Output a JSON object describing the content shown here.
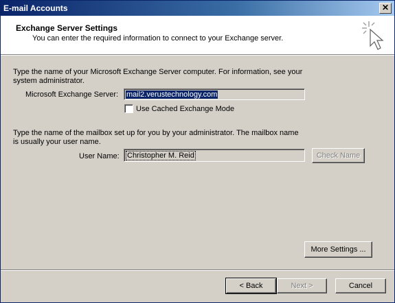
{
  "window": {
    "title": "E-mail Accounts",
    "close_glyph": "✕"
  },
  "header": {
    "title": "Exchange Server Settings",
    "subtitle": "You can enter the required information to connect to your Exchange server.",
    "icon": "wizard-cursor-icon"
  },
  "server_section": {
    "instruction_line1": "Type the name of your Microsoft Exchange Server computer. For information, see your",
    "instruction_line2": "system administrator.",
    "server_label": "Microsoft Exchange Server:",
    "server_value": "mail2.verustechnology.com",
    "cached_mode_label": "Use Cached Exchange Mode",
    "cached_mode_checked": false
  },
  "mailbox_section": {
    "instruction_line1": "Type the name of the mailbox set up for you by your administrator. The mailbox name",
    "instruction_line2": "is usually your user name.",
    "user_label": "User Name:",
    "user_value": "Christopher M. Reid",
    "check_name_label": "Check Name"
  },
  "buttons": {
    "more_settings": "More Settings ...",
    "back": "< Back",
    "next": "Next >",
    "cancel": "Cancel"
  },
  "colors": {
    "titlebar": "#0a246a",
    "face": "#d4d0c8",
    "selection": "#0a246a"
  }
}
